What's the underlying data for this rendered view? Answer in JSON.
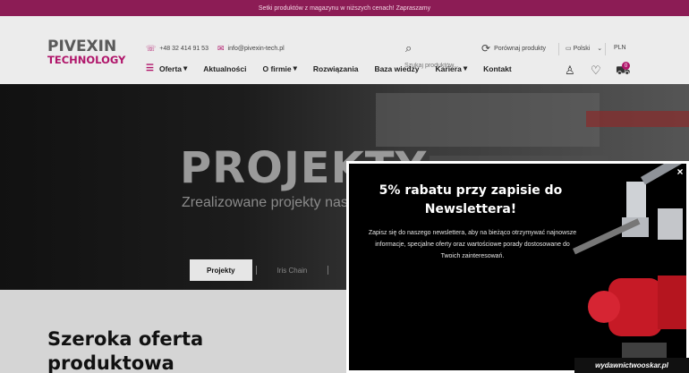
{
  "topbar": {
    "text": "Setki produktów z magazynu w niższych cenach! Zapraszamy"
  },
  "logo": {
    "line1": "PIVEXIN",
    "line2": "TECHNOLOGY"
  },
  "header": {
    "phone": "+48 32 414 91 53",
    "email": "info@pivexin-tech.pl",
    "search_placeholder": "Szukaj produktów...",
    "compare_label": "Porównaj produkty",
    "language": "Polski",
    "currency": "PLN"
  },
  "nav": {
    "items": [
      {
        "label": "Oferta",
        "dropdown": true
      },
      {
        "label": "Aktualności",
        "dropdown": false
      },
      {
        "label": "O firmie",
        "dropdown": true
      },
      {
        "label": "Rozwiązania",
        "dropdown": false
      },
      {
        "label": "Baza wiedzy",
        "dropdown": false
      },
      {
        "label": "Kariera",
        "dropdown": true
      },
      {
        "label": "Kontakt",
        "dropdown": false
      }
    ]
  },
  "cart": {
    "count": "0"
  },
  "hero": {
    "title": "PROJEKTY",
    "subtitle": "Zrealizowane projekty nas",
    "tabs": [
      "Projekty",
      "Iris Chain",
      "I"
    ]
  },
  "section": {
    "title": "Szeroka oferta produktowa"
  },
  "popup": {
    "title": "5% rabatu przy zapisie do Newslettera!",
    "text": "Zapisz się do naszego newslettera, aby na bieżąco otrzymywać najnowsze informacje, specjalne oferty oraz wartościowe porady dostosowane do Twoich zainteresowań.",
    "close": "×"
  },
  "watermark": {
    "text": "wydawnictwooskar.pl"
  },
  "colors": {
    "brand": "#b0156a",
    "topbar": "#8c1c55"
  },
  "icons": [
    "phone-icon",
    "mail-icon",
    "search-icon",
    "compare-icon",
    "flag-icon",
    "chevron-down-icon",
    "menu-icon",
    "user-icon",
    "heart-icon",
    "cart-icon",
    "close-icon"
  ]
}
